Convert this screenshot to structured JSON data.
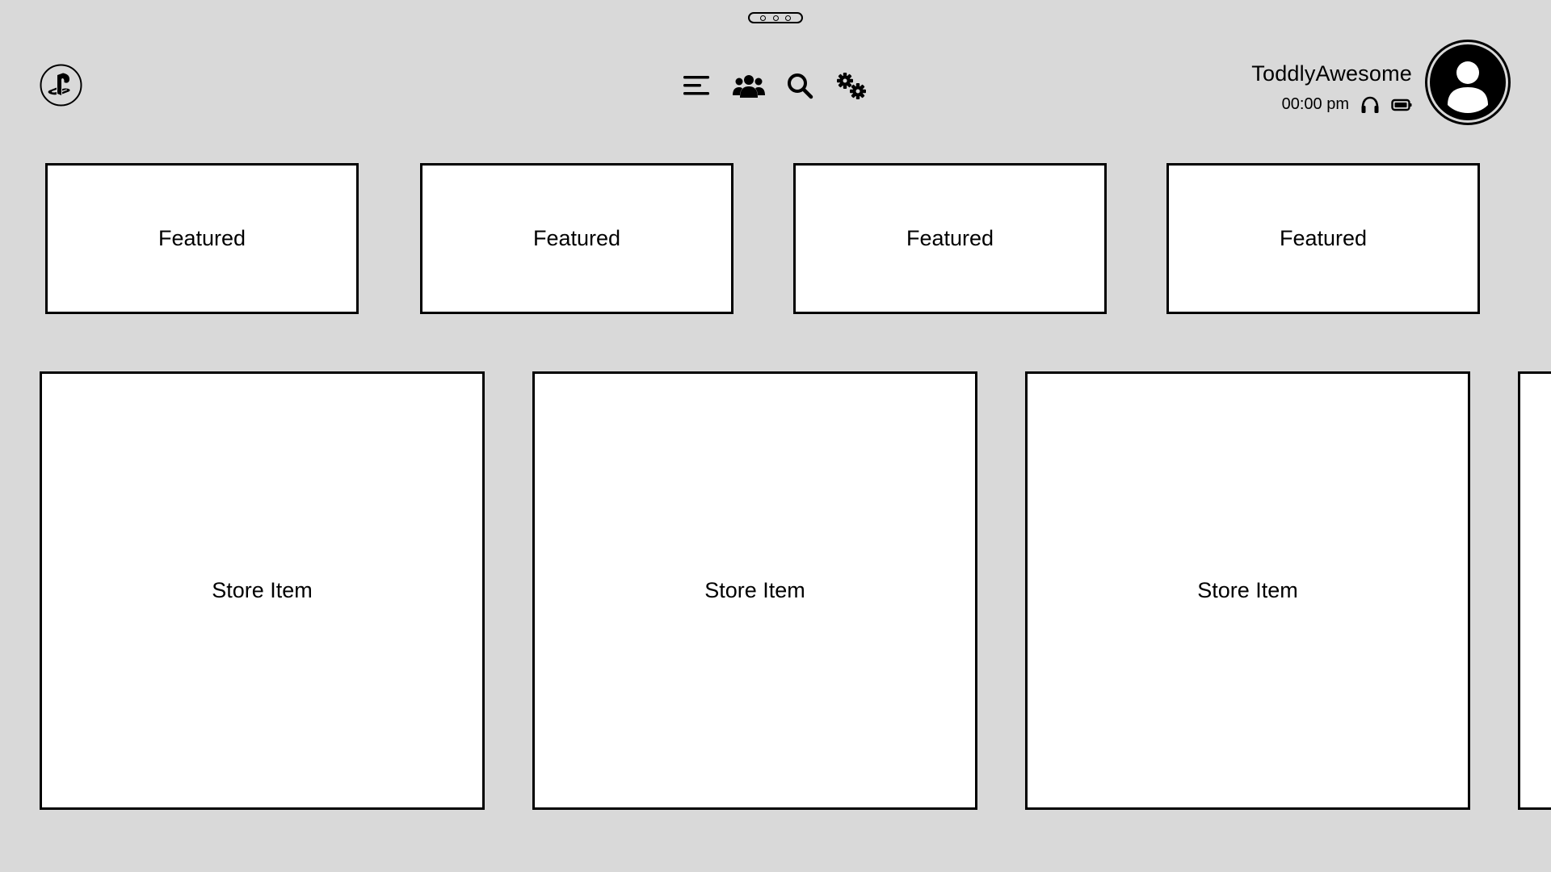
{
  "topbar": {
    "page_indicator_dots": 3,
    "logo_icon": "playstation-logo-icon",
    "nav_icons": [
      "menu-icon",
      "friends-icon",
      "search-icon",
      "settings-icon"
    ]
  },
  "user": {
    "name": "ToddlyAwesome",
    "time": "00:00 pm",
    "status_icons": [
      "headset-icon",
      "battery-icon"
    ],
    "avatar_icon": "user-avatar-icon"
  },
  "featured": {
    "items": [
      {
        "label": "Featured"
      },
      {
        "label": "Featured"
      },
      {
        "label": "Featured"
      },
      {
        "label": "Featured"
      }
    ]
  },
  "store": {
    "items": [
      {
        "label": "Store Item"
      },
      {
        "label": "Store Item"
      },
      {
        "label": "Store Item"
      }
    ]
  }
}
